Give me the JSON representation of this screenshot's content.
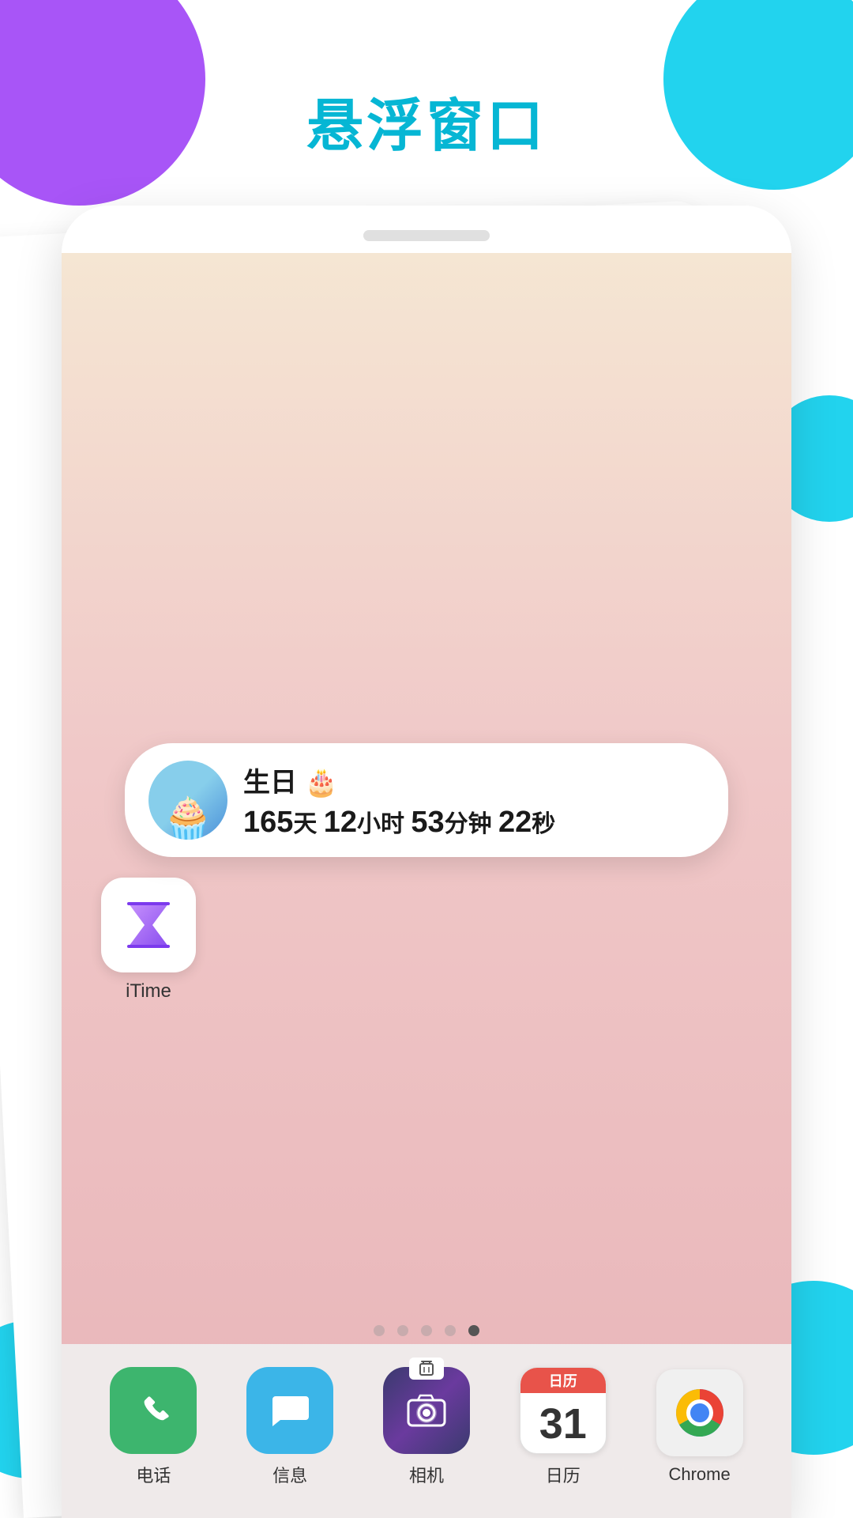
{
  "page": {
    "title": "悬浮窗口",
    "title_color": "#06b6d4"
  },
  "floating_widget": {
    "event_name": "生日 🎂",
    "countdown": {
      "days": "165天",
      "hours": "12小时",
      "minutes": "53分钟",
      "seconds": "22秒"
    },
    "days_num": "165",
    "hours_num": "12",
    "minutes_num": "53",
    "seconds_num": "22"
  },
  "page_dots": {
    "total": 5,
    "active_index": 4
  },
  "dock_apps": [
    {
      "id": "phone",
      "label": "电话",
      "emoji": "📞",
      "color": "#3db56e"
    },
    {
      "id": "messages",
      "label": "信息",
      "emoji": "💬",
      "color": "#3bb5e8"
    },
    {
      "id": "camera",
      "label": "相机",
      "emoji": "📷",
      "color": "gradient"
    },
    {
      "id": "calendar",
      "label": "日历",
      "number": "31",
      "color": "#f0f0f0"
    },
    {
      "id": "chrome",
      "label": "Chrome",
      "color": "#f0f0f0"
    }
  ],
  "itime_app": {
    "label": "iTime",
    "icon": "⧗"
  }
}
